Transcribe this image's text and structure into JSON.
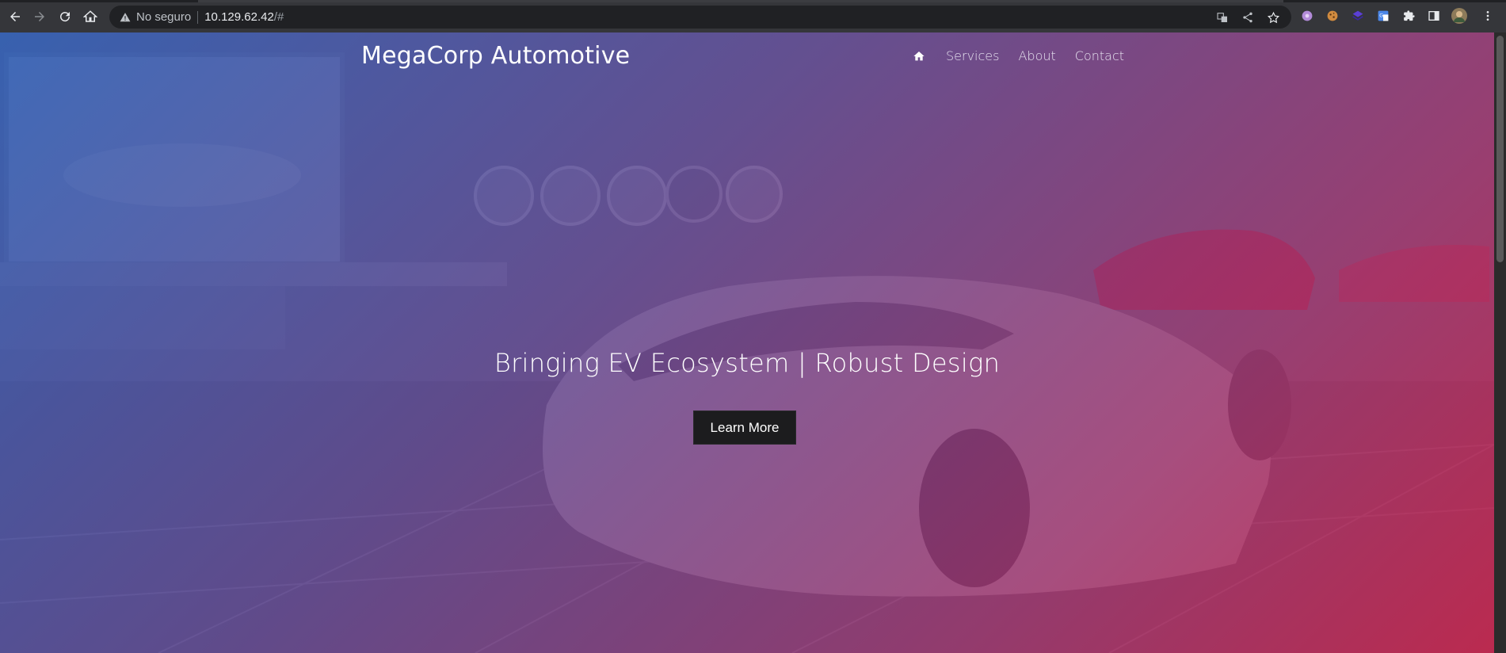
{
  "browser": {
    "security_label": "No seguro",
    "url_host": "10.129.62.42",
    "url_path": "/#",
    "icons": [
      "back-icon",
      "forward-icon",
      "reload-icon",
      "home-icon",
      "warning-icon",
      "translate-icon",
      "share-icon",
      "bookmark-star-icon",
      "extension-purple-icon",
      "cookie-icon",
      "extension-layers-icon",
      "translate-extension-icon",
      "puzzle-icon",
      "sidebar-icon",
      "profile-avatar",
      "menu-dots-icon"
    ]
  },
  "site": {
    "brand": "MegaCorp Automotive",
    "nav": {
      "home_icon": "home-icon",
      "items": [
        "Services",
        "About",
        "Contact"
      ]
    },
    "hero": {
      "title": "Bringing EV Ecosystem | Robust Design",
      "button": "Learn More"
    }
  },
  "colors": {
    "gradient_start": "#2a5ab4",
    "gradient_mid": "#5a3c8c",
    "gradient_end": "#c81e46",
    "button_bg": "#1c1c1e",
    "chrome_bg": "#35363a"
  }
}
